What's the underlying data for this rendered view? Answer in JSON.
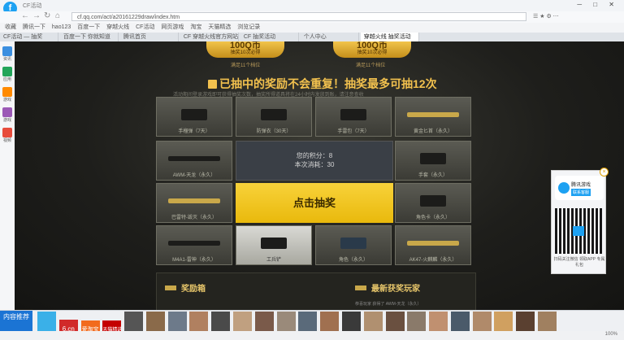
{
  "browser": {
    "title": "CF活动",
    "url": "cf.qq.com/act/a20161229draw/index.htm",
    "bookmarks": [
      "收藏",
      "腾讯一下",
      "hao123",
      "百度一下",
      "穿越火线",
      "CF活动",
      "网页游戏",
      "淘宝",
      "天猫精选",
      "浏览记录"
    ],
    "tabs": [
      "CF活动 — 抽奖",
      "百度一下 你就知道",
      "腾讯首页",
      "CF 穿越火线官方网站",
      "CF 抽奖活动",
      "个人中心",
      "穿越火线 抽奖活动"
    ]
  },
  "sidebar": {
    "items": [
      "资讯",
      "应用",
      "游戏",
      "游戏",
      "视频"
    ]
  },
  "promo": {
    "banner_left": {
      "amount": "100Q币",
      "sub": "抽奖10次必得"
    },
    "banner_right": {
      "amount": "100Q币",
      "sub": "抽奖10次必得"
    },
    "caption_left": "满足11个档位",
    "caption_right": "满足11个档位",
    "headline": "已抽中的奖励不会重复！抽奖最多可抽12次",
    "subline": "活动期间登录游戏即可获得抽奖次数，抽奖所得道具将在24小时内发放到账，请注意查收"
  },
  "prizes": [
    {
      "name": "手榴弹（7天）"
    },
    {
      "name": "防弹衣（30天）"
    },
    {
      "name": "手雷包（7天）"
    },
    {
      "name": "黄金匕首（永久）"
    },
    {
      "name": "AWM-天龙（永久）"
    },
    {
      "name": "手套（永久）"
    },
    {
      "name": "巴雷特-毁灭（永久）"
    },
    {
      "name": "角色卡（永久）"
    },
    {
      "name": "M4A1-雷神（永久）"
    },
    {
      "name": "工兵铲"
    },
    {
      "name": "角色（永久）"
    },
    {
      "name": "AK47-火麒麟（永久）"
    }
  ],
  "draw_info": {
    "used": "您的积分：8",
    "remain": "本次消耗：30"
  },
  "draw_button": "点击抽奖",
  "lower": {
    "left": "奖励箱",
    "right": "最新获奖玩家",
    "ticker": "恭喜玩家 获得了 AWM-天龙（永久）"
  },
  "float": {
    "name": "腾讯游戏",
    "btn": "联系客服",
    "caption": "扫码关注微信 领取APP 专属礼包"
  },
  "news": {
    "label": "内容推荐",
    "ads": [
      "6.cn",
      "爱淘宝",
      "天猫精选"
    ]
  },
  "status": {
    "zoom": "100%"
  }
}
